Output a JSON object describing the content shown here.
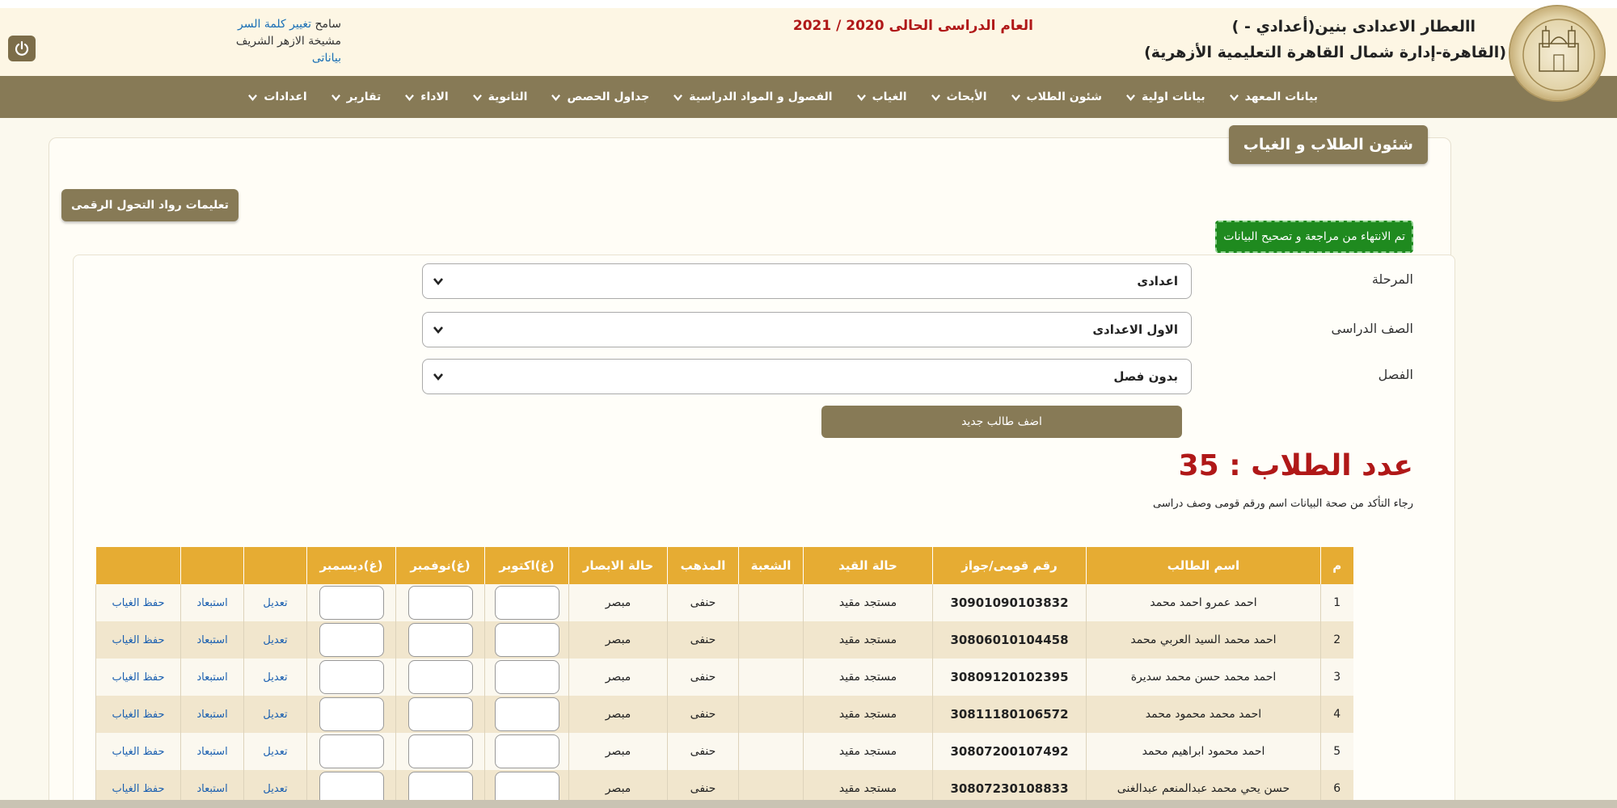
{
  "header": {
    "school_name": "االعطار الاعدادى بنين(أعدادي - )",
    "administration": "(القاهرة-إدارة شمال القاهرة التعليمية الأزهرية)",
    "academic_year": "العام الدراسى الحالى 2020 / 2021",
    "user_name": "سامح",
    "change_password": "تغيير كلمة السر",
    "org": "مشيخة الازهر الشريف",
    "my_data": "بياناتى"
  },
  "nav": [
    {
      "label": "بيانات المعهد"
    },
    {
      "label": "بيانات اولية"
    },
    {
      "label": "شئون الطلاب"
    },
    {
      "label": "الأبحاث"
    },
    {
      "label": "الغياب"
    },
    {
      "label": "الفصول و المواد الدراسية"
    },
    {
      "label": "جداول الحصص"
    },
    {
      "label": "الثانوية"
    },
    {
      "label": "الاداء"
    },
    {
      "label": "تقارير"
    },
    {
      "label": "اعدادات"
    }
  ],
  "page": {
    "section_title": "شئون الطلاب و الغياب",
    "instructions_button": "تعليمات رواد التحول الرقمى",
    "done_button": "تم الانتهاء من مراجعة و تصحيح البيانات"
  },
  "filters": {
    "stage_label": "المرحلة",
    "stage_value": "اعدادى",
    "grade_label": "الصف الدراسى",
    "grade_value": "الاول الاعدادى",
    "class_label": "الفصل",
    "class_value": "بدون فصل",
    "add_student": "اضف طالب جديد"
  },
  "summary": {
    "count_text": "عدد الطلاب : 35",
    "note": "رجاء التأكد من صحة البيانات اسم ورقم قومى وصف دراسى"
  },
  "table": {
    "headers": [
      "م",
      "اسم الطالب",
      "رقم قومى/جواز",
      "حالة القيد",
      "الشعبة",
      "المذهب",
      "حالة الابصار",
      "(غ)اكتوبر",
      "(غ)نوفمبر",
      "(غ)ديسمبر",
      "",
      "",
      ""
    ],
    "rows": [
      {
        "n": "1",
        "name": "احمد عمرو احمد محمد",
        "id": "30901090103832",
        "status": "مستجد مقيد",
        "branch": "",
        "madhhab": "حنفى",
        "sight": "مبصر",
        "edit": "تعديل",
        "exclude": "استبعاد",
        "save": "حفظ الغياب"
      },
      {
        "n": "2",
        "name": "احمد محمد السيد العربي محمد",
        "id": "30806010104458",
        "status": "مستجد مقيد",
        "branch": "",
        "madhhab": "حنفى",
        "sight": "مبصر",
        "edit": "تعديل",
        "exclude": "استبعاد",
        "save": "حفظ الغياب"
      },
      {
        "n": "3",
        "name": "احمد محمد حسن محمد سديرة",
        "id": "30809120102395",
        "status": "مستجد مقيد",
        "branch": "",
        "madhhab": "حنفى",
        "sight": "مبصر",
        "edit": "تعديل",
        "exclude": "استبعاد",
        "save": "حفظ الغياب"
      },
      {
        "n": "4",
        "name": "احمد محمد محمود محمد",
        "id": "30811180106572",
        "status": "مستجد مقيد",
        "branch": "",
        "madhhab": "حنفى",
        "sight": "مبصر",
        "edit": "تعديل",
        "exclude": "استبعاد",
        "save": "حفظ الغياب"
      },
      {
        "n": "5",
        "name": "احمد محمود ابراهيم محمد",
        "id": "30807200107492",
        "status": "مستجد مقيد",
        "branch": "",
        "madhhab": "حنفى",
        "sight": "مبصر",
        "edit": "تعديل",
        "exclude": "استبعاد",
        "save": "حفظ الغياب"
      },
      {
        "n": "6",
        "name": "حسن يحي محمد عبدالمنعم عبدالغنى",
        "id": "30807230108833",
        "status": "مستجد مقيد",
        "branch": "",
        "madhhab": "حنفى",
        "sight": "مبصر",
        "edit": "تعديل",
        "exclude": "استبعاد",
        "save": "حفظ الغياب"
      }
    ]
  },
  "icons": {
    "power": "power-icon",
    "chevron": "chevron-down-icon",
    "logo": "al-azhar-logo"
  },
  "colors": {
    "nav_bg": "#877a56",
    "table_header": "#e6ac33",
    "accent_red": "#b01818",
    "done_green": "#1f8a1f"
  }
}
